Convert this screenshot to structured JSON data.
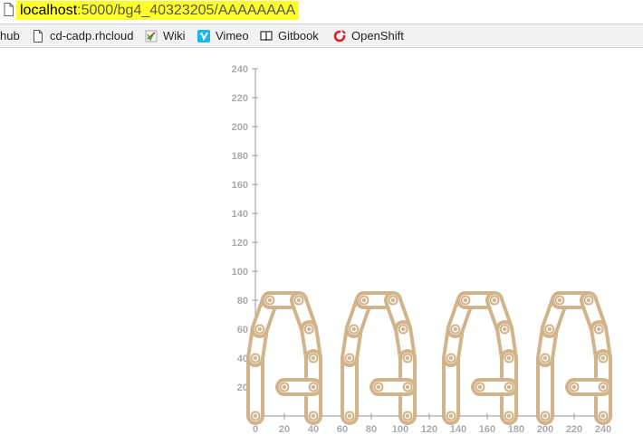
{
  "browser": {
    "url_host": "localhost",
    "url_rest": ":5000/bg4_40323205/AAAAAAAA",
    "url_highlight_color": "#ffff2a"
  },
  "bookmarks": [
    {
      "label": "hub",
      "icon": "none"
    },
    {
      "label": "cd-cadp.rhcloud",
      "icon": "document-icon"
    },
    {
      "label": "Wiki",
      "icon": "wiki-icon"
    },
    {
      "label": "Vimeo",
      "icon": "vimeo-icon"
    },
    {
      "label": "Gitbook",
      "icon": "gitbook-icon"
    },
    {
      "label": "OpenShift",
      "icon": "openshift-icon"
    }
  ],
  "chart_data": {
    "type": "scatter",
    "x_ticks": [
      "0",
      "20",
      "40",
      "60",
      "80",
      "100",
      "120",
      "140",
      "160",
      "180",
      "200",
      "220",
      "240"
    ],
    "y_ticks": [
      "20",
      "40",
      "60",
      "80",
      "100",
      "120",
      "140",
      "160",
      "180",
      "200",
      "220",
      "240"
    ],
    "xlim": [
      0,
      240
    ],
    "ylim": [
      0,
      240
    ],
    "link_color": "#d2b48c",
    "letters": [
      "A",
      "A",
      "A",
      "A"
    ],
    "letter_offsets_x": [
      0,
      65,
      135,
      200
    ],
    "letter_points": [
      {
        "x": 0,
        "y": 0
      },
      {
        "x": 0,
        "y": 40
      },
      {
        "x": 3,
        "y": 60
      },
      {
        "x": 10,
        "y": 80
      },
      {
        "x": 30,
        "y": 80
      },
      {
        "x": 37,
        "y": 60
      },
      {
        "x": 40,
        "y": 40
      },
      {
        "x": 40,
        "y": 0
      },
      {
        "x": 20,
        "y": 20
      },
      {
        "x": 40,
        "y": 20
      }
    ],
    "letter_links": [
      [
        0,
        1
      ],
      [
        1,
        2
      ],
      [
        2,
        3
      ],
      [
        3,
        4
      ],
      [
        4,
        5
      ],
      [
        5,
        6
      ],
      [
        6,
        7
      ],
      [
        8,
        9
      ]
    ]
  }
}
